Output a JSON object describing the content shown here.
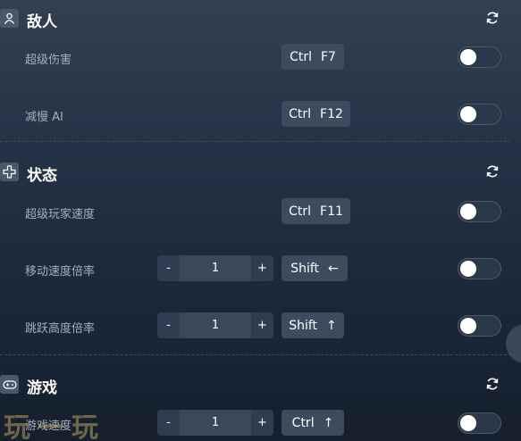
{
  "sections": [
    {
      "title": "敌人",
      "icon": "person-icon",
      "rows": [
        {
          "label": "超级伤害",
          "hotkey": [
            "Ctrl",
            "F7"
          ],
          "toggle": false
        },
        {
          "label": "减慢 AI",
          "hotkey": [
            "Ctrl",
            "F12"
          ],
          "toggle": false
        }
      ]
    },
    {
      "title": "状态",
      "icon": "dpad-icon",
      "rows": [
        {
          "label": "超级玩家速度",
          "hotkey": [
            "Ctrl",
            "F11"
          ],
          "toggle": false
        },
        {
          "label": "移动速度倍率",
          "stepper": {
            "minus": "-",
            "value": "1",
            "plus": "+"
          },
          "hotkey": [
            "Shift",
            "←"
          ],
          "toggle": false
        },
        {
          "label": "跳跃高度倍率",
          "stepper": {
            "minus": "-",
            "value": "1",
            "plus": "+"
          },
          "hotkey": [
            "Shift",
            "↑"
          ],
          "toggle": false
        }
      ]
    },
    {
      "title": "游戏",
      "icon": "gamepad-icon",
      "rows": [
        {
          "label": "游戏速度",
          "stepper": {
            "minus": "-",
            "value": "1",
            "plus": "+"
          },
          "hotkey": [
            "Ctrl",
            "↑"
          ],
          "toggle": false
        }
      ]
    }
  ],
  "watermark": "玩一玩",
  "colors": {
    "background_top": "#324052",
    "background_bottom": "#151f2d",
    "button": "#3d4b5e",
    "label": "#a4b0c0"
  }
}
